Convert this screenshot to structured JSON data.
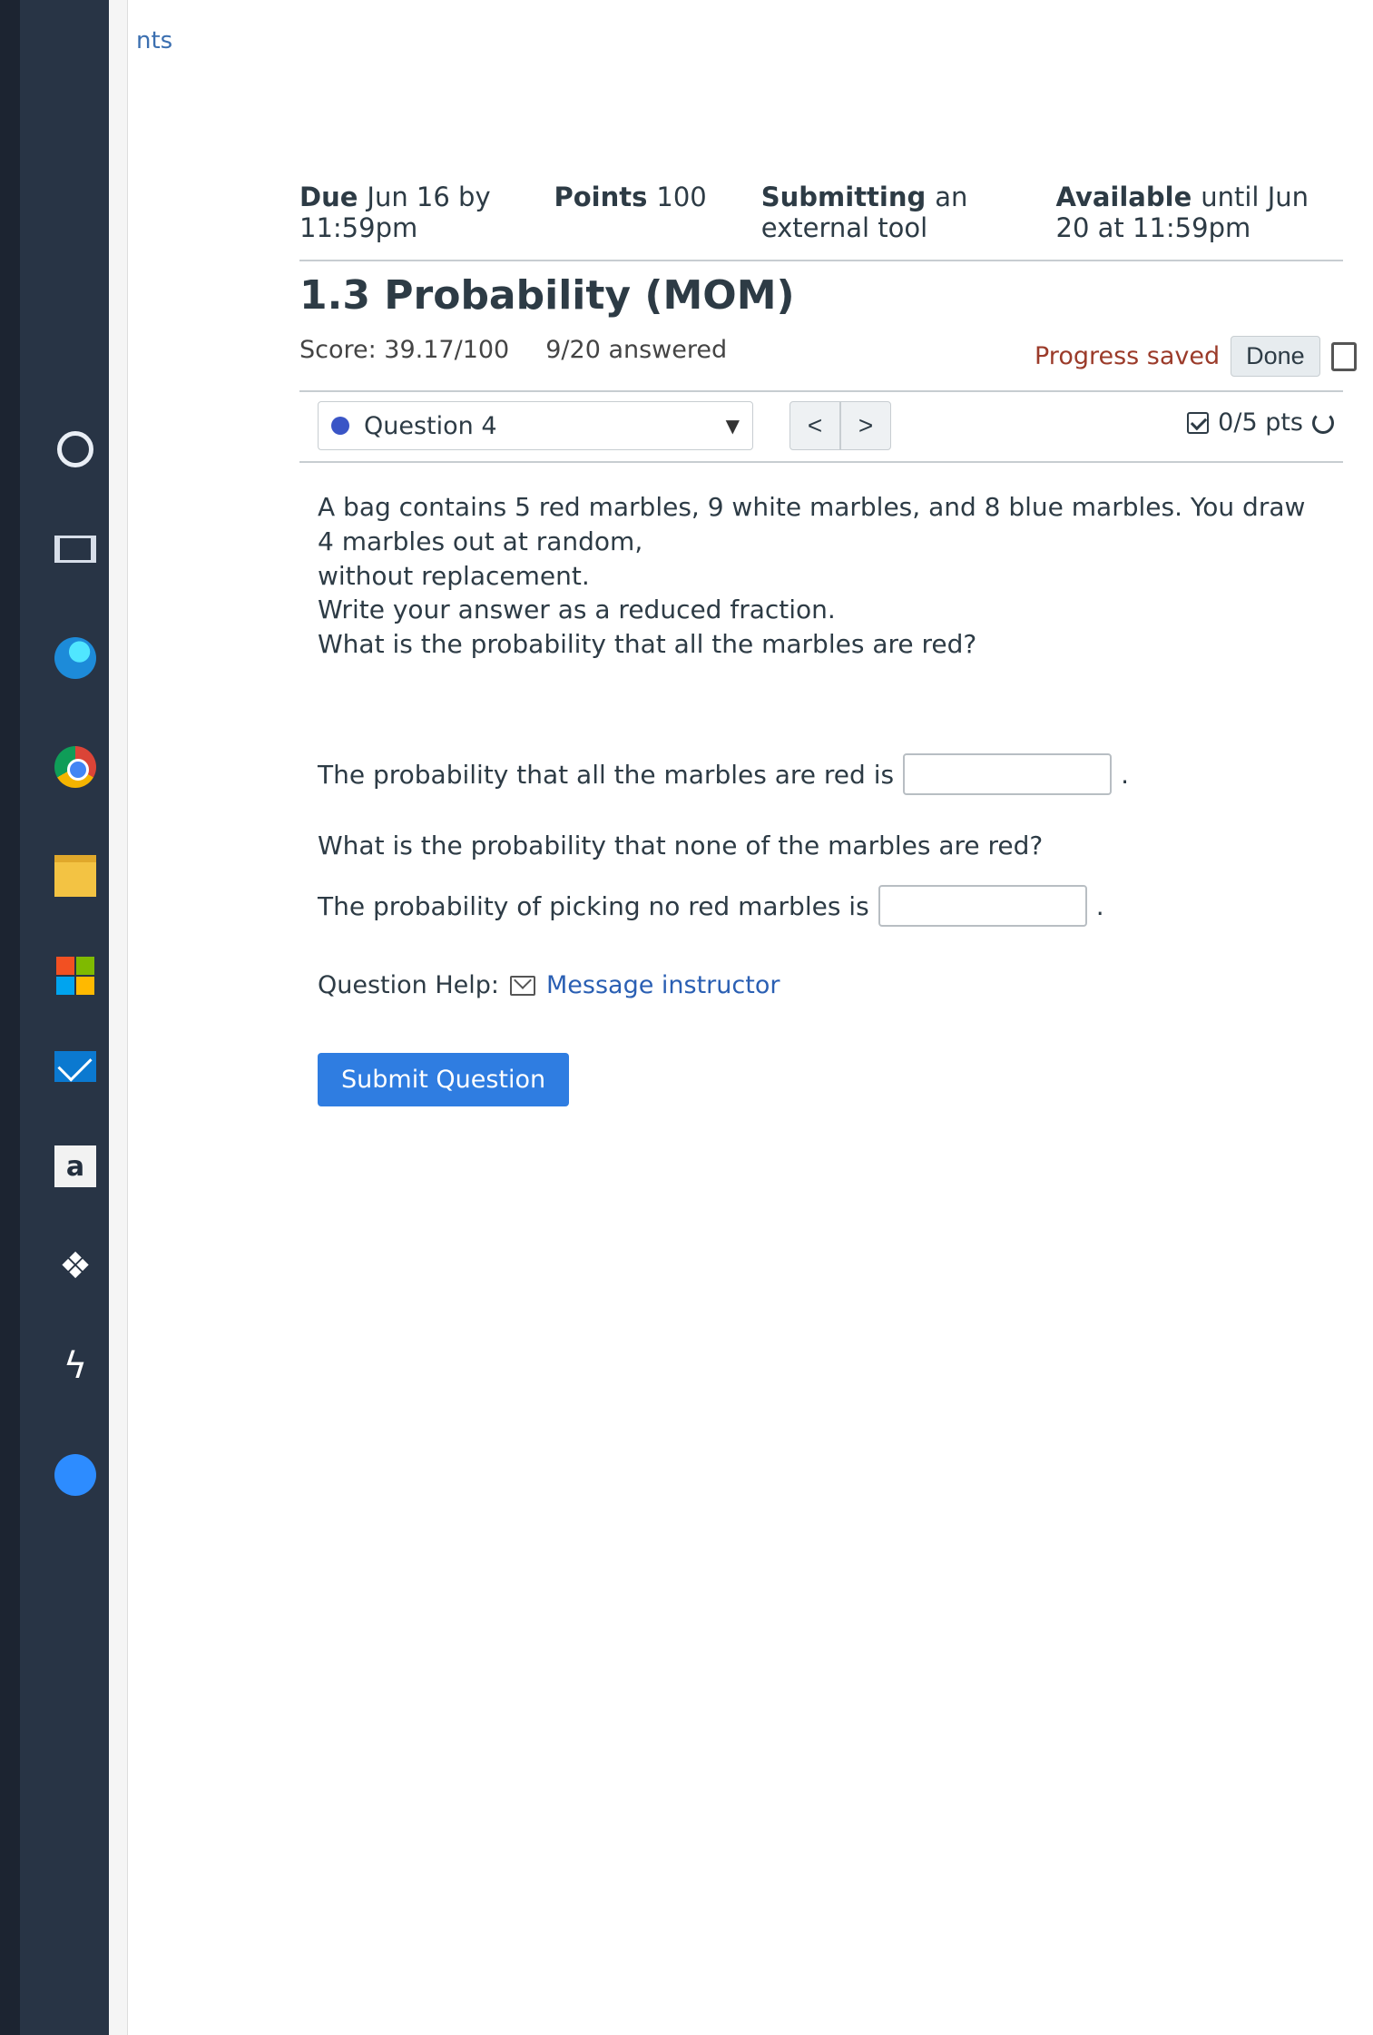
{
  "nav": {
    "partial_label": "nts"
  },
  "assignment": {
    "due_label": "Due",
    "due_value": "Jun 16 by 11:59pm",
    "points_label": "Points",
    "points_value": "100",
    "submitting_label": "Submitting",
    "submitting_value": "an external tool",
    "available_label": "Available",
    "available_value": "until Jun 20 at 11:59pm"
  },
  "header": {
    "title": "1.3 Probability (MOM)",
    "score": "Score: 39.17/100",
    "answered": "9/20 answered",
    "progress_status": "Progress saved",
    "done_label": "Done"
  },
  "question_nav": {
    "selected": "Question 4",
    "prev_label": "<",
    "next_label": ">",
    "points": "0/5 pts"
  },
  "question": {
    "text_line1": "A bag contains 5 red marbles, 9 white marbles, and 8 blue marbles. You draw 4 marbles out at random,",
    "text_line2": "without replacement.",
    "text_line3": "Write your answer as a reduced fraction.",
    "text_line4": "What is the probability that all the marbles are red?",
    "part1_prompt": "The probability that all the marbles are red is",
    "part1_value": "",
    "part2_question": "What is the probability that none of the marbles are red?",
    "part2_prompt": "The probability of picking no red marbles is",
    "part2_value": ""
  },
  "help": {
    "label": "Question Help:",
    "link_label": "Message instructor"
  },
  "submit_label": "Submit Question",
  "colors": {
    "accent": "#2f7de1",
    "link": "#2a5fb3",
    "progress_saved": "#9b3b2a",
    "taskbar": "#283445",
    "question_dot": "#3a55c6"
  },
  "icons": {
    "taskbar": [
      "search-icon",
      "task-view-icon",
      "edge-icon",
      "chrome-icon",
      "file-explorer-icon",
      "store-icon",
      "mail-icon",
      "amazon-icon",
      "dropbox-icon",
      "winamp-icon",
      "zoom-icon"
    ],
    "header": [
      "print-icon"
    ],
    "question": [
      "check-box-icon",
      "retry-icon",
      "mail-icon"
    ]
  }
}
